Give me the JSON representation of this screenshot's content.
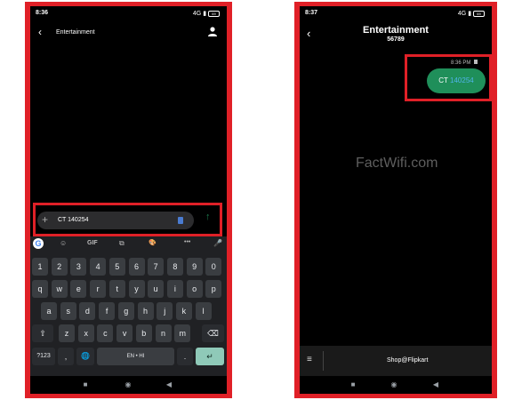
{
  "left": {
    "status_time": "8:36",
    "status_right": "4G",
    "battery": "69",
    "title": "Entertainment",
    "input_value": "CT 140254",
    "keyboard": {
      "toolbar": [
        "G",
        "☺",
        "GIF",
        "⧉",
        "🎨",
        "•••",
        "🎤"
      ],
      "row_digits": [
        "1",
        "2",
        "3",
        "4",
        "5",
        "6",
        "7",
        "8",
        "9",
        "0"
      ],
      "row1": [
        "q",
        "w",
        "e",
        "r",
        "t",
        "y",
        "u",
        "i",
        "o",
        "p"
      ],
      "row2": [
        "a",
        "s",
        "d",
        "f",
        "g",
        "h",
        "j",
        "k",
        "l"
      ],
      "row3": [
        "z",
        "x",
        "c",
        "v",
        "b",
        "n",
        "m"
      ],
      "sym_label": "?123",
      "comma": ",",
      "space_label": "EN • HI",
      "period": "."
    }
  },
  "right": {
    "status_time": "8:37",
    "status_right": "4G",
    "battery": "69",
    "title": "Entertainment",
    "subtitle": "56789",
    "msg_time": "8:36 PM",
    "msg_prefix": "CT",
    "msg_code": "140254",
    "watermark": "FactWifi.com",
    "bottom_label": "Shop@Flipkart"
  },
  "colors": {
    "frame": "#e02027",
    "bubble": "#1f8f5a",
    "send_arrow": "#1e7d4f",
    "enter_key": "#8fc9b8"
  }
}
